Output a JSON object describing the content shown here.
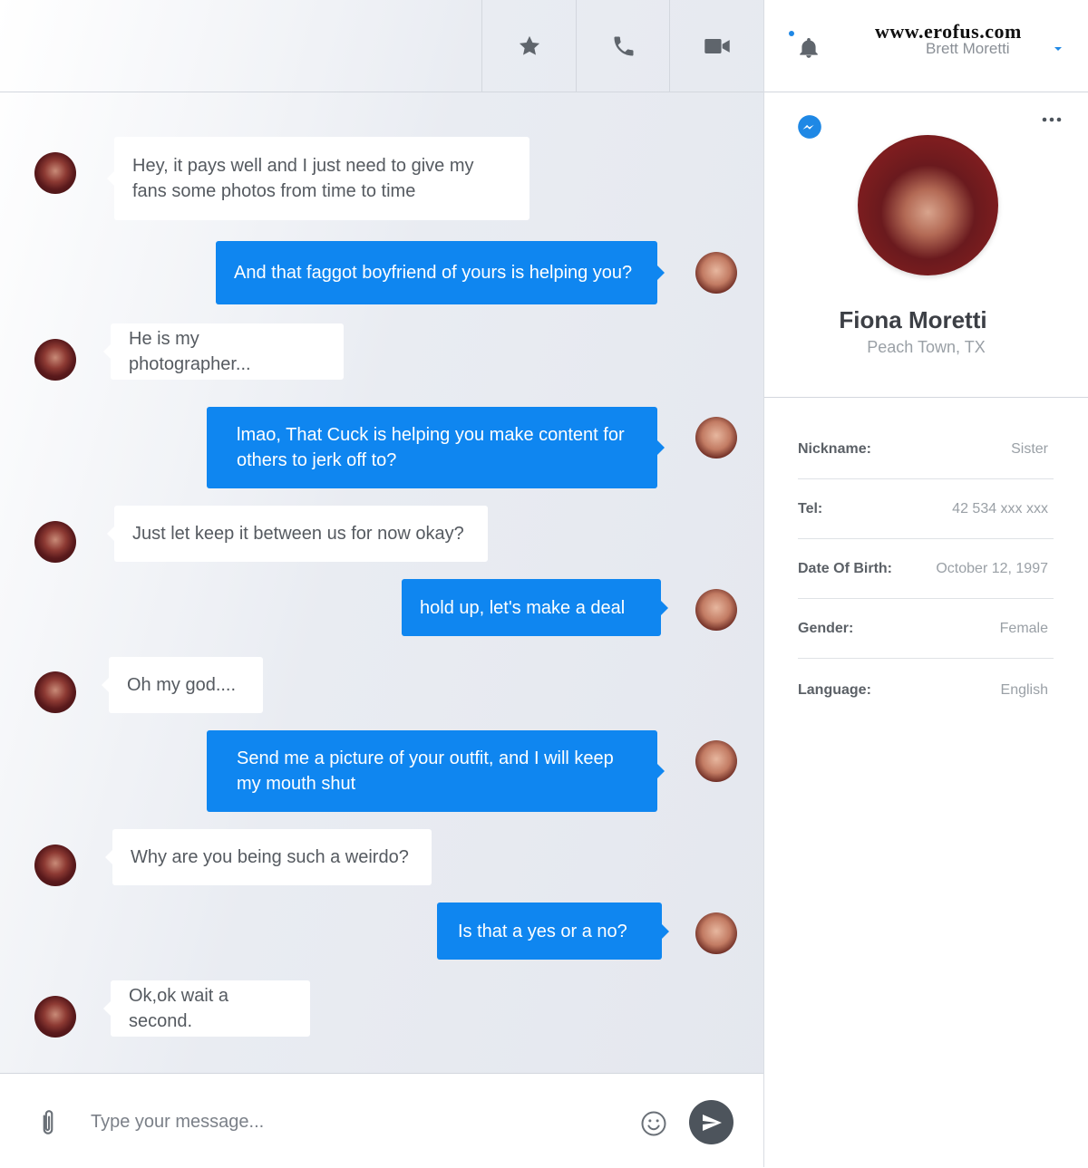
{
  "header": {
    "star_icon": "star-icon",
    "call_icon": "phone-icon",
    "video_icon": "video-camera-icon"
  },
  "user": {
    "name": "Brett Moretti",
    "watermark": "www.erofus.com"
  },
  "profile": {
    "name": "Fiona Moretti",
    "location": "Peach Town, TX",
    "details": [
      {
        "label": "Nickname:",
        "value": "Sister"
      },
      {
        "label": "Tel:",
        "value": "42 534 xxx xxx"
      },
      {
        "label": "Date Of Birth:",
        "value": "October 12, 1997"
      },
      {
        "label": "Gender:",
        "value": "Female"
      },
      {
        "label": "Language:",
        "value": "English"
      }
    ]
  },
  "messages": [
    {
      "side": "in",
      "text": "Hey, it pays well and I just need to give my fans some photos from time to time"
    },
    {
      "side": "out",
      "text": "And that faggot boyfriend of yours is helping you?"
    },
    {
      "side": "in",
      "text": "He is my photographer..."
    },
    {
      "side": "out",
      "text": "lmao, That Cuck is helping you make content for others to jerk off to?"
    },
    {
      "side": "in",
      "text": "Just let keep it between us for now okay?"
    },
    {
      "side": "out",
      "text": "hold up, let's make a deal"
    },
    {
      "side": "in",
      "text": "Oh my god...."
    },
    {
      "side": "out",
      "text": "Send me a picture of your outfit, and I will keep my mouth shut"
    },
    {
      "side": "in",
      "text": "Why are you being such a weirdo?"
    },
    {
      "side": "out",
      "text": "Is that a yes or a no?"
    },
    {
      "side": "in",
      "text": "Ok,ok wait a second."
    }
  ],
  "composer": {
    "placeholder": "Type your message..."
  },
  "colors": {
    "accent": "#0f86f0",
    "incoming_bubble": "#ffffff",
    "send_button": "#4d545c"
  }
}
